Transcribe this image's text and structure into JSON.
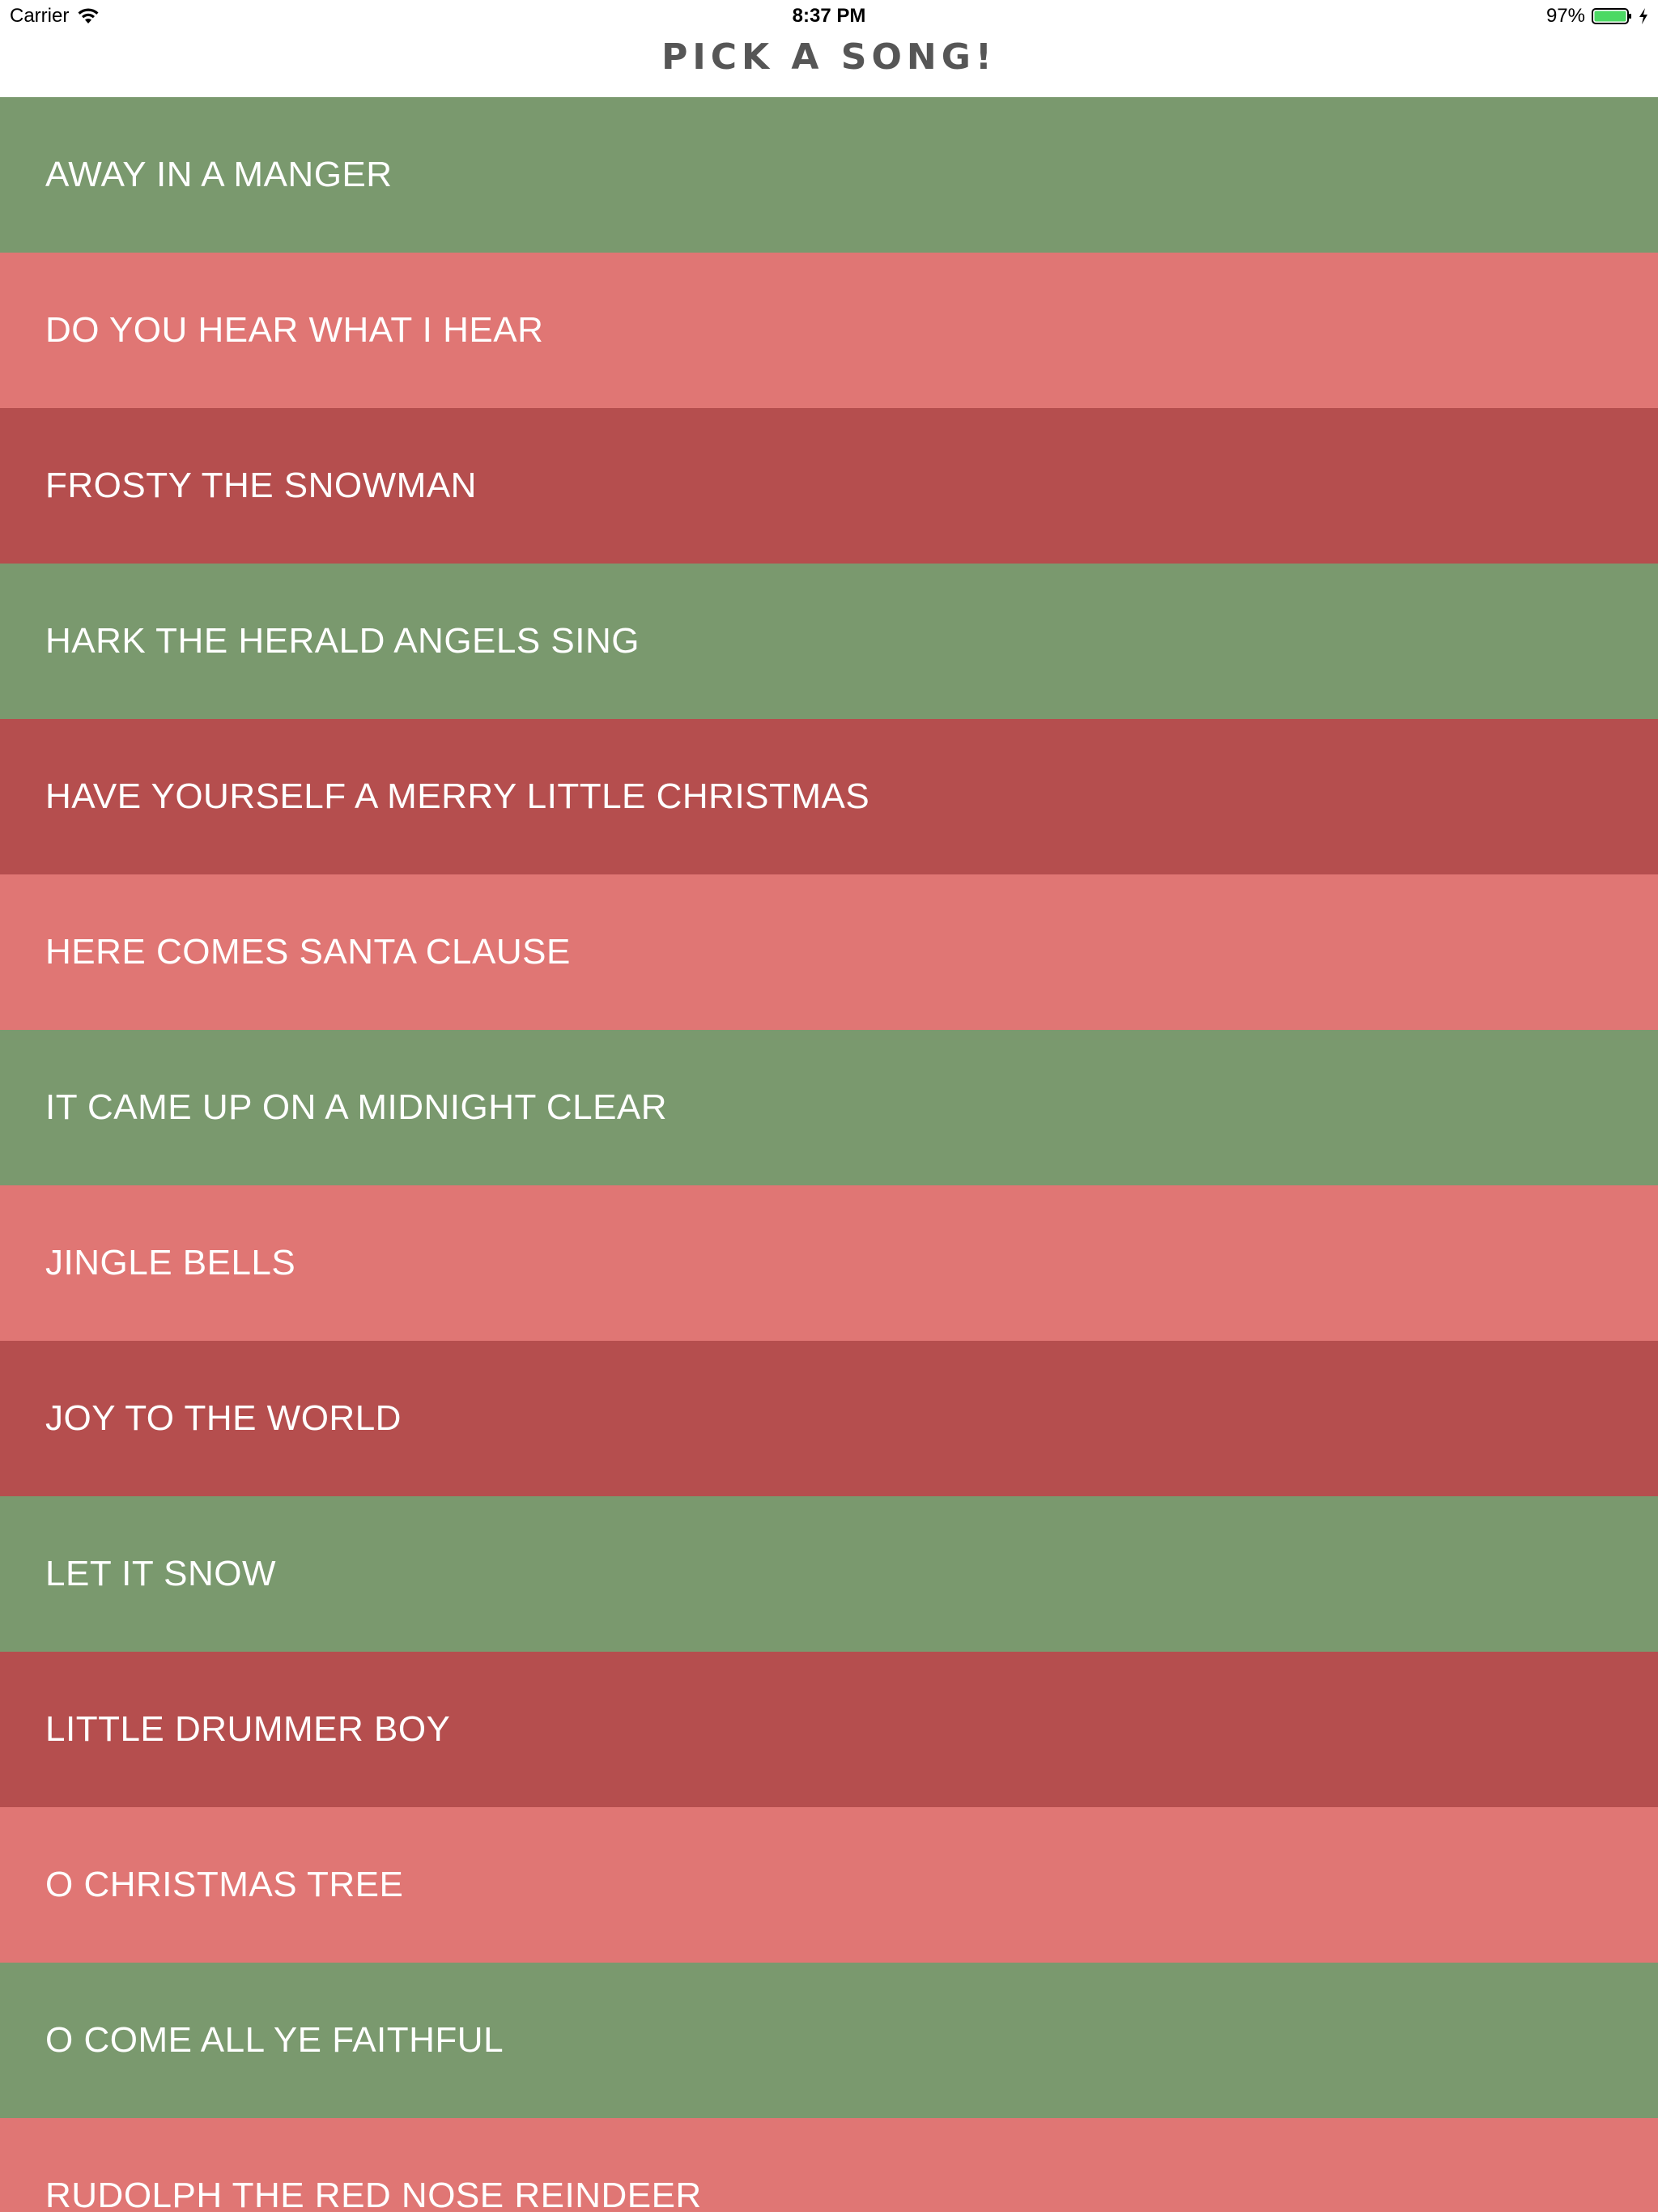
{
  "status_bar": {
    "carrier": "Carrier",
    "time": "8:37 PM",
    "battery": "97%",
    "icons": [
      "wifi-icon",
      "battery-icon",
      "charging-bolt-icon"
    ]
  },
  "nav": {
    "title": "PICK A SONG!"
  },
  "colors": {
    "green": "#7a996e",
    "pink": "#e07674",
    "red": "#b54e4e",
    "battery_fill": "#4cd964",
    "title": "#565656"
  },
  "songs": [
    {
      "label": "AWAY IN A MANGER",
      "color": "#7a996e"
    },
    {
      "label": "DO YOU HEAR WHAT I HEAR",
      "color": "#e07674"
    },
    {
      "label": "FROSTY THE SNOWMAN",
      "color": "#b54e4e"
    },
    {
      "label": "HARK THE HERALD ANGELS SING",
      "color": "#7a996e"
    },
    {
      "label": "HAVE YOURSELF A MERRY LITTLE CHRISTMAS",
      "color": "#b54e4e"
    },
    {
      "label": "HERE COMES SANTA CLAUSE",
      "color": "#e07674"
    },
    {
      "label": "IT CAME UP ON A MIDNIGHT CLEAR",
      "color": "#7a996e"
    },
    {
      "label": "JINGLE BELLS",
      "color": "#e07674"
    },
    {
      "label": "JOY TO THE WORLD",
      "color": "#b54e4e"
    },
    {
      "label": "LET IT SNOW",
      "color": "#7a996e"
    },
    {
      "label": "LITTLE DRUMMER BOY",
      "color": "#b54e4e"
    },
    {
      "label": "O CHRISTMAS TREE",
      "color": "#e07674"
    },
    {
      "label": "O COME ALL YE FAITHFUL",
      "color": "#7a996e"
    },
    {
      "label": "RUDOLPH THE RED NOSE REINDEER",
      "color": "#e07674"
    }
  ]
}
